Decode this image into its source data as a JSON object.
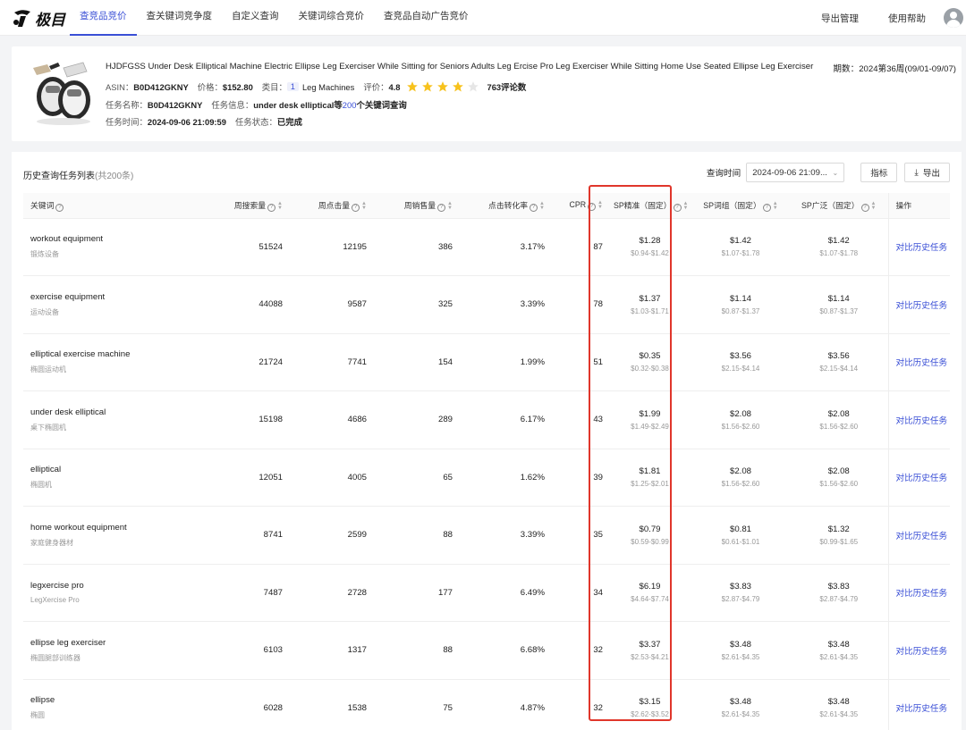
{
  "app": {
    "logo_text": "极目",
    "nav": [
      {
        "label": "查竞品竞价",
        "active": true
      },
      {
        "label": "查关键词竞争度",
        "active": false
      },
      {
        "label": "自定义查询",
        "active": false
      },
      {
        "label": "关键词综合竞价",
        "active": false
      },
      {
        "label": "查竞品自动广告竞价",
        "active": false
      }
    ],
    "right_links": [
      "导出管理",
      "使用帮助"
    ]
  },
  "product": {
    "title": "HJDFGSS Under Desk Elliptical Machine Electric Ellipse Leg Exerciser While Sitting for Seniors Adults Leg Ercise Pro Leg Exerciser While Sitting Home Use Seated Ellipse Leg Exerciser",
    "period_label": "期数：",
    "period_value": "2024第36周(09/01-09/07)",
    "asin_label": "ASIN：",
    "asin": "B0D412GKNY",
    "price_label": "价格：",
    "price": "$152.80",
    "category_label": "类目：",
    "category_rank": "1",
    "category": "Leg Machines",
    "rating_label": "评价：",
    "rating": "4.8",
    "stars_full": 4,
    "reviews": "763评论数",
    "task_name_label": "任务名称：",
    "task_name": "B0D412GKNY",
    "task_info_label": "任务信息：",
    "task_info_prefix": "under desk elliptical等",
    "task_info_count": "200",
    "task_info_suffix": "个关键词查询",
    "task_time_label": "任务时间：",
    "task_time": "2024-09-06 21:09:59",
    "task_status_label": "任务状态：",
    "task_status": "已完成"
  },
  "list": {
    "title": "历史查询任务列表",
    "count": "(共200条)",
    "query_time_label": "查询时间",
    "query_time_value": "2024-09-06 21:09...",
    "metrics_button": "指标",
    "export_button": "导出",
    "columns": {
      "keyword": "关键词",
      "weekly_search": "周搜索量",
      "weekly_clicks": "周点击量",
      "weekly_sales": "周销售量",
      "ctr": "点击转化率",
      "cpr": "CPR",
      "sp_exact": "SP精准（固定）",
      "sp_phrase": "SP词组（固定）",
      "sp_broad": "SP广泛（固定）",
      "op": "操作"
    },
    "op_label": "对比历史任务",
    "rows": [
      {
        "kw": "workout equipment",
        "cn": "锻炼设备",
        "search": "51524",
        "clicks": "12195",
        "sales": "386",
        "ctr": "3.17%",
        "cpr": "87",
        "exact": "$1.28",
        "exact_r": "$0.94-$1.42",
        "phrase": "$1.42",
        "phrase_r": "$1.07-$1.78",
        "broad": "$1.42",
        "broad_r": "$1.07-$1.78"
      },
      {
        "kw": "exercise equipment",
        "cn": "运动设备",
        "search": "44088",
        "clicks": "9587",
        "sales": "325",
        "ctr": "3.39%",
        "cpr": "78",
        "exact": "$1.37",
        "exact_r": "$1.03-$1.71",
        "phrase": "$1.14",
        "phrase_r": "$0.87-$1.37",
        "broad": "$1.14",
        "broad_r": "$0.87-$1.37"
      },
      {
        "kw": "elliptical exercise machine",
        "cn": "椭圆运动机",
        "search": "21724",
        "clicks": "7741",
        "sales": "154",
        "ctr": "1.99%",
        "cpr": "51",
        "exact": "$0.35",
        "exact_r": "$0.32-$0.38",
        "phrase": "$3.56",
        "phrase_r": "$2.15-$4.14",
        "broad": "$3.56",
        "broad_r": "$2.15-$4.14"
      },
      {
        "kw": "under desk elliptical",
        "cn": "桌下椭圆机",
        "search": "15198",
        "clicks": "4686",
        "sales": "289",
        "ctr": "6.17%",
        "cpr": "43",
        "exact": "$1.99",
        "exact_r": "$1.49-$2.49",
        "phrase": "$2.08",
        "phrase_r": "$1.56-$2.60",
        "broad": "$2.08",
        "broad_r": "$1.56-$2.60"
      },
      {
        "kw": "elliptical",
        "cn": "椭圆机",
        "search": "12051",
        "clicks": "4005",
        "sales": "65",
        "ctr": "1.62%",
        "cpr": "39",
        "exact": "$1.81",
        "exact_r": "$1.25-$2.01",
        "phrase": "$2.08",
        "phrase_r": "$1.56-$2.60",
        "broad": "$2.08",
        "broad_r": "$1.56-$2.60"
      },
      {
        "kw": "home workout equipment",
        "cn": "家庭健身器材",
        "search": "8741",
        "clicks": "2599",
        "sales": "88",
        "ctr": "3.39%",
        "cpr": "35",
        "exact": "$0.79",
        "exact_r": "$0.59-$0.99",
        "phrase": "$0.81",
        "phrase_r": "$0.61-$1.01",
        "broad": "$1.32",
        "broad_r": "$0.99-$1.65"
      },
      {
        "kw": "legxercise pro",
        "cn": "LegXercise Pro",
        "search": "7487",
        "clicks": "2728",
        "sales": "177",
        "ctr": "6.49%",
        "cpr": "34",
        "exact": "$6.19",
        "exact_r": "$4.64-$7.74",
        "phrase": "$3.83",
        "phrase_r": "$2.87-$4.79",
        "broad": "$3.83",
        "broad_r": "$2.87-$4.79"
      },
      {
        "kw": "ellipse leg exerciser",
        "cn": "椭圆腿部训练器",
        "search": "6103",
        "clicks": "1317",
        "sales": "88",
        "ctr": "6.68%",
        "cpr": "32",
        "exact": "$3.37",
        "exact_r": "$2.53-$4.21",
        "phrase": "$3.48",
        "phrase_r": "$2.61-$4.35",
        "broad": "$3.48",
        "broad_r": "$2.61-$4.35"
      },
      {
        "kw": "ellipse",
        "cn": "椭圆",
        "search": "6028",
        "clicks": "1538",
        "sales": "75",
        "ctr": "4.87%",
        "cpr": "32",
        "exact": "$3.15",
        "exact_r": "$2.62-$3.52",
        "phrase": "$3.48",
        "phrase_r": "$2.61-$4.35",
        "broad": "$3.48",
        "broad_r": "$2.61-$4.35"
      }
    ]
  },
  "colors": {
    "accent": "#3a4fd6",
    "highlight": "#e0362b",
    "star": "#f7c21c"
  }
}
